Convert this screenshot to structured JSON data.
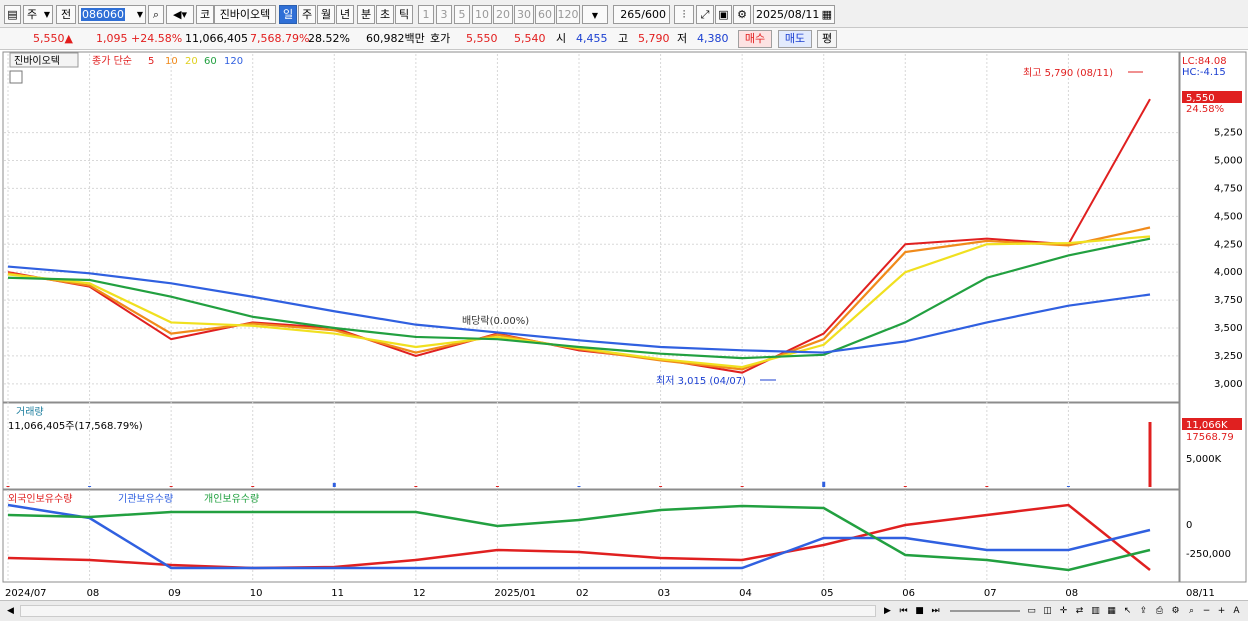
{
  "toolbar": {
    "market_label": "주",
    "scope_label": "전",
    "code": "086060",
    "coin_label": "코",
    "stock_name": "진바이오텍",
    "periods": [
      "일",
      "주",
      "월",
      "년",
      "분",
      "초",
      "틱"
    ],
    "active_period": "일",
    "intervals": [
      "1",
      "3",
      "5",
      "10",
      "20",
      "30",
      "60",
      "120"
    ],
    "count": "265",
    "count_total": "/600",
    "date": "2025/08/11"
  },
  "quote": {
    "price": "5,550▲",
    "change": "1,095",
    "change_pct": "+24.58%",
    "volume": "11,066,405",
    "volume_pct": "7,568.79%",
    "turnover_pct": "28.52%",
    "amount": "60,982백만",
    "hoga_label": "호가",
    "ask": "5,550",
    "bid": "5,540",
    "open_label": "시",
    "open": "4,455",
    "high_label": "고",
    "high": "5,790",
    "low_label": "저",
    "low": "4,380",
    "buy_label": "매수",
    "sell_label": "매도",
    "eval_label": "평"
  },
  "price_panel": {
    "legend_name": "진바이오텍",
    "legend_ma_label": "종가 단순",
    "ma_periods": [
      "5",
      "10",
      "20",
      "60",
      "120"
    ],
    "ma_colors": [
      "#e02020",
      "#f08a1a",
      "#f0e020",
      "#22a040",
      "#3060e0"
    ],
    "lc": "LC:84.08",
    "hc": "HC:-4.15",
    "high_annotation": "최고 5,790 (08/11)",
    "low_annotation": "최저 3,015 (04/07)",
    "dividend_annotation": "배당락(0.00%)",
    "current_price_tag": "5,550",
    "current_pct_tag": "24.58%",
    "y_ticks": [
      "5,250",
      "5,000",
      "4,750",
      "4,500",
      "4,250",
      "4,000",
      "3,750",
      "3,500",
      "3,250",
      "3,000"
    ]
  },
  "volume_panel": {
    "title": "거래량",
    "value_text": "11,066,405주(17,568.79%)",
    "tag_value": "11,066K",
    "tag_pct": "17568.79",
    "y_tick": "5,000K"
  },
  "holding_panel": {
    "legends": [
      "외국인보유수량",
      "기관보유수량",
      "개인보유수량"
    ],
    "legend_colors": [
      "#e02020",
      "#3060e0",
      "#22a040"
    ],
    "y_ticks": [
      "0",
      "-250,000"
    ]
  },
  "x_axis": {
    "labels": [
      "2024/07",
      "08",
      "09",
      "10",
      "11",
      "12",
      "2025/01",
      "02",
      "03",
      "04",
      "05",
      "06",
      "07",
      "08"
    ],
    "last_label": "08/11"
  },
  "chart_data": {
    "type": "line",
    "title": "진바이오텍",
    "x": [
      "2024/07",
      "08",
      "09",
      "10",
      "11",
      "12",
      "2025/01",
      "02",
      "03",
      "04",
      "05",
      "06",
      "07",
      "08",
      "08/11"
    ],
    "series": [
      {
        "name": "5",
        "values": [
          4000,
          3870,
          3400,
          3550,
          3500,
          3250,
          3450,
          3300,
          3220,
          3100,
          3450,
          4250,
          4300,
          4250,
          5550
        ]
      },
      {
        "name": "10",
        "values": [
          3990,
          3880,
          3450,
          3540,
          3480,
          3280,
          3440,
          3310,
          3210,
          3130,
          3400,
          4180,
          4280,
          4240,
          4400
        ]
      },
      {
        "name": "20",
        "values": [
          3980,
          3900,
          3550,
          3520,
          3450,
          3330,
          3420,
          3320,
          3220,
          3150,
          3350,
          4000,
          4250,
          4260,
          4320
        ]
      },
      {
        "name": "60",
        "values": [
          3950,
          3930,
          3780,
          3600,
          3500,
          3420,
          3400,
          3330,
          3270,
          3230,
          3260,
          3550,
          3950,
          4150,
          4300
        ]
      },
      {
        "name": "120",
        "values": [
          4050,
          3990,
          3900,
          3780,
          3650,
          3530,
          3460,
          3390,
          3330,
          3300,
          3280,
          3380,
          3550,
          3700,
          3800
        ]
      }
    ],
    "volume": [
      50,
      60,
      70,
      40,
      700,
      50,
      40,
      30,
      30,
      40,
      900,
      120,
      60,
      60,
      11066
    ],
    "ylim": [
      2900,
      5900
    ],
    "y_scale": "linear",
    "grid": true,
    "legend": "top-left"
  }
}
